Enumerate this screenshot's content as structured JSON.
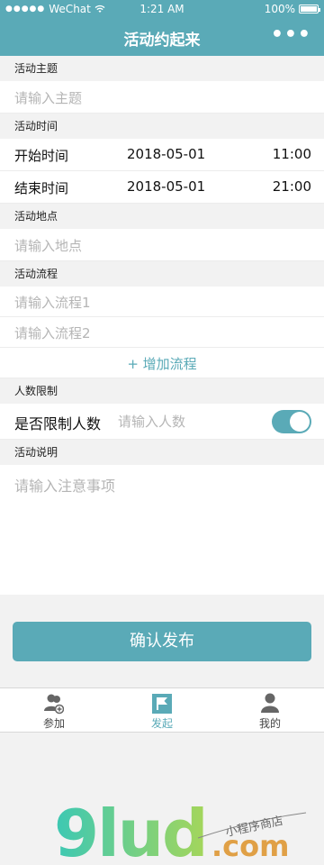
{
  "status_bar": {
    "carrier": "WeChat",
    "signal_dots": "●●●●●",
    "time": "1:21 AM",
    "battery": "100%"
  },
  "nav": {
    "title": "活动约起来",
    "more": "•••"
  },
  "sections": {
    "topic": {
      "header": "活动主题",
      "placeholder": "请输入主题"
    },
    "time": {
      "header": "活动时间",
      "start": {
        "label": "开始时间",
        "date": "2018-05-01",
        "time": "11:00"
      },
      "end": {
        "label": "结束时间",
        "date": "2018-05-01",
        "time": "21:00"
      }
    },
    "location": {
      "header": "活动地点",
      "placeholder": "请输入地点"
    },
    "flow": {
      "header": "活动流程",
      "placeholders": [
        "请输入流程1",
        "请输入流程2"
      ],
      "add_label": "+ 增加流程"
    },
    "limit": {
      "header": "人数限制",
      "label": "是否限制人数",
      "placeholder": "请输入人数",
      "toggle_on": true
    },
    "description": {
      "header": "活动说明",
      "placeholder": "请输入注意事项"
    }
  },
  "submit_label": "确认发布",
  "tabbar": {
    "items": [
      {
        "label": "参加",
        "icon": "user-add-icon",
        "active": false
      },
      {
        "label": "发起",
        "icon": "flag-icon",
        "active": true
      },
      {
        "label": "我的",
        "icon": "person-icon",
        "active": false
      }
    ]
  },
  "watermark": {
    "logo_text": "9lud",
    "domain": ".com",
    "tagline": "小程序商店"
  },
  "colors": {
    "accent": "#5aaab7",
    "background": "#f2f2f2",
    "placeholder": "#b5b5b5"
  }
}
